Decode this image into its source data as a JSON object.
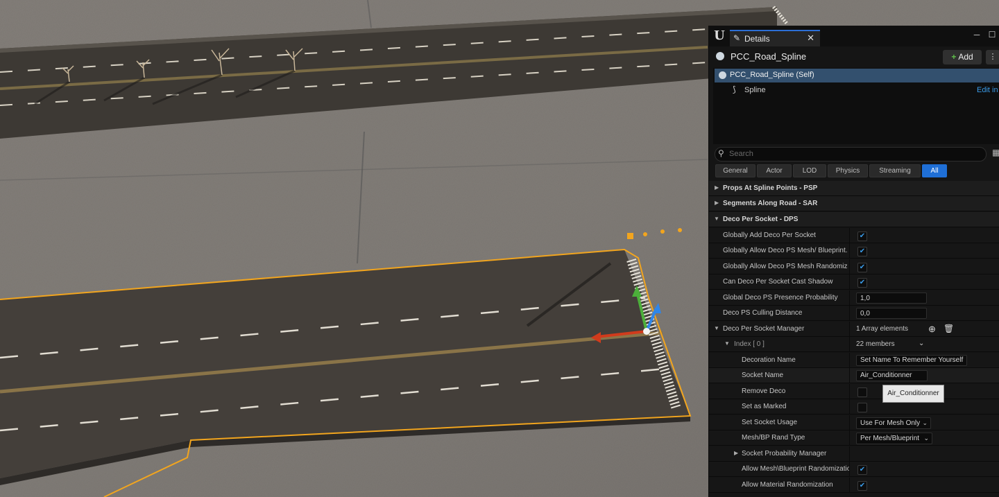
{
  "panel": {
    "tab_title": "Details",
    "actor_name": "PCC_Road_Spline",
    "add_label": "Add",
    "components": [
      {
        "label": "PCC_Road_Spline (Self)"
      },
      {
        "label": "Spline",
        "action": "Edit in"
      }
    ],
    "search_placeholder": "Search",
    "filters": [
      "General",
      "Actor",
      "LOD",
      "Physics",
      "Streaming",
      "All"
    ],
    "active_filter": "All",
    "categories": {
      "psp": "Props At Spline Points - PSP",
      "sar": "Segments Along Road - SAR",
      "dps": "Deco Per Socket - DPS"
    },
    "props": {
      "globally_add": {
        "label": "Globally Add Deco Per Socket",
        "checked": true
      },
      "allow_mesh_bp": {
        "label": "Globally Allow Deco PS Mesh/ Blueprint...",
        "checked": true
      },
      "allow_mesh_rand": {
        "label": "Globally Allow Deco PS Mesh Randomizat...",
        "checked": true
      },
      "cast_shadow": {
        "label": "Can Deco Per Socket Cast Shadow",
        "checked": true
      },
      "presence_prob": {
        "label": "Global Deco PS Presence Probability",
        "value": "1,0"
      },
      "culling_dist": {
        "label": "Deco PS Culling Distance",
        "value": "0,0"
      },
      "manager": {
        "label": "Deco Per Socket Manager",
        "value": "1 Array elements"
      },
      "index": {
        "label": "Index [ 0 ]",
        "value": "22 members"
      },
      "decoration_name": {
        "label": "Decoration Name",
        "value": "Set Name To Remember Yourself"
      },
      "socket_name": {
        "label": "Socket Name",
        "value": "Air_Conditionner"
      },
      "remove_deco": {
        "label": "Remove Deco",
        "checked": false
      },
      "set_marked": {
        "label": "Set as Marked",
        "checked": false
      },
      "socket_usage": {
        "label": "Set Socket Usage",
        "value": "Use For Mesh Only"
      },
      "rand_type": {
        "label": "Mesh/BP Rand Type",
        "value": "Per Mesh/Blueprint"
      },
      "socket_prob_mgr": {
        "label": "Socket Probability Manager"
      },
      "allow_mesh_bp_rand": {
        "label": "Allow Mesh\\Blueprint Randomization",
        "checked": true
      },
      "allow_mat_rand": {
        "label": "Allow Material Randomization",
        "checked": true
      }
    },
    "tooltip": "Air_Conditionner"
  },
  "icons": {
    "engine_logo": "unreal-logo",
    "check": "checkmark",
    "expand": "triangle-right",
    "collapse": "triangle-down"
  }
}
